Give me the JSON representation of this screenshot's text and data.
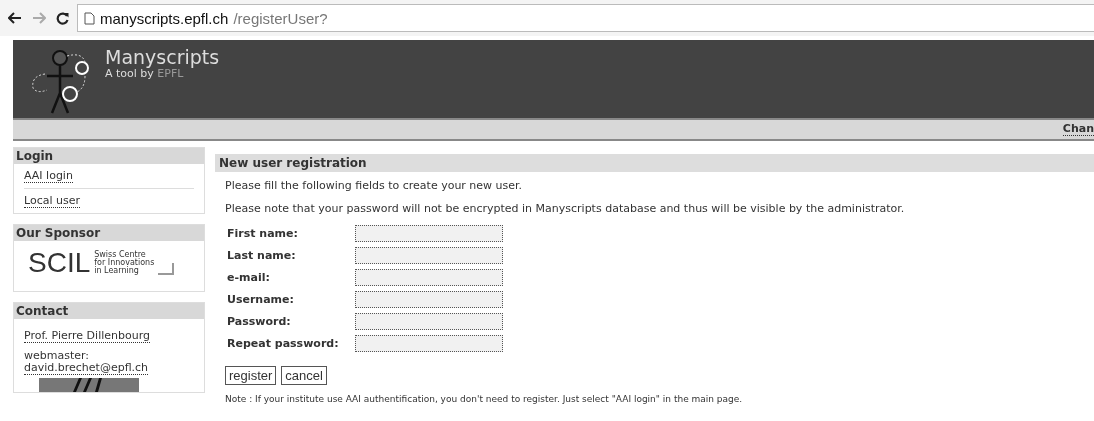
{
  "browser": {
    "url_host": "manyscripts.epfl.ch",
    "url_path": "/registerUser?"
  },
  "header": {
    "title": "Manyscripts",
    "subtitle": "A tool by",
    "subtitle_link": "EPFL"
  },
  "nav_bar": {
    "link": "Chan"
  },
  "sidebar": [
    {
      "kind": "links",
      "title": "Login",
      "items": [
        "AAI login",
        "Local user"
      ]
    },
    {
      "kind": "sponsor",
      "title": "Our Sponsor",
      "logo_text": "SCIL",
      "logo_caption": [
        "Swiss Centre",
        "for Innovations",
        "in Learning"
      ]
    },
    {
      "kind": "contact",
      "title": "Contact",
      "person": "Prof. Pierre Dillenbourg",
      "label": "webmaster:",
      "email": "david.brechet@epfl.ch"
    }
  ],
  "main": {
    "title": "New user registration",
    "intro": [
      "Please fill the following fields to create your new user.",
      "Please note that your password will not be encrypted in Manyscripts database and thus will be visible by the administrator."
    ],
    "fields": [
      {
        "label": "First name:"
      },
      {
        "label": "Last name:"
      },
      {
        "label": "e-mail:"
      },
      {
        "label": "Username:"
      },
      {
        "label": "Password:"
      },
      {
        "label": "Repeat password:"
      }
    ],
    "buttons": [
      "register",
      "cancel"
    ],
    "note": "Note : If your institute use AAI authentification, you don't need to register. Just select \"AAI login\" in the main page."
  }
}
